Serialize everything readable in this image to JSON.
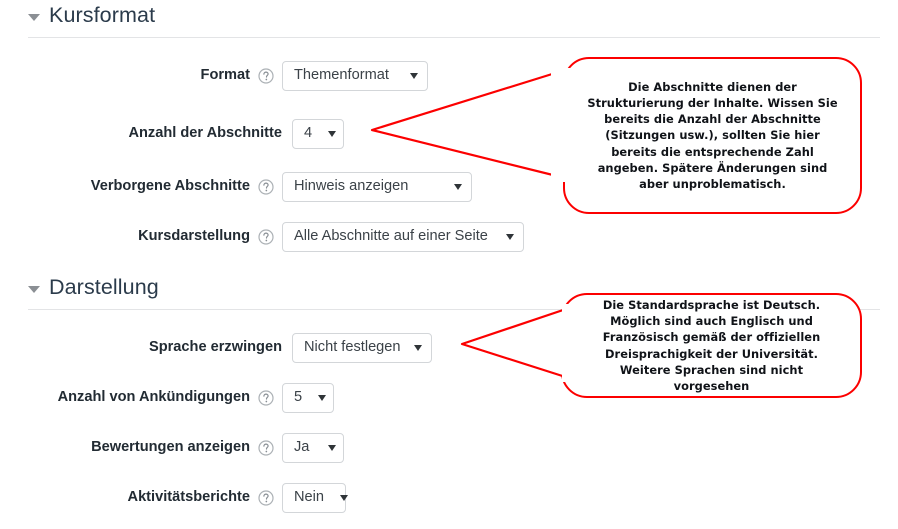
{
  "sections": [
    {
      "id": "kursformat",
      "title": "Kursformat",
      "caret_icon": "caret-down-icon",
      "rows": [
        {
          "id": "format",
          "label": "Format",
          "help_icon": "help-circle-icon",
          "has_help": true,
          "value": "Themenformat",
          "dropdown_icon": "caret-down-icon"
        },
        {
          "id": "anzahl-der-abschnitte",
          "label": "Anzahl der Abschnitte",
          "help_icon": "help-circle-icon",
          "has_help": false,
          "value": "4",
          "dropdown_icon": "caret-down-icon"
        },
        {
          "id": "verborgene-abschnitte",
          "label": "Verborgene Abschnitte",
          "help_icon": "help-circle-icon",
          "has_help": true,
          "value": "Hinweis anzeigen",
          "dropdown_icon": "caret-down-icon"
        },
        {
          "id": "kursdarstellung",
          "label": "Kursdarstellung",
          "help_icon": "help-circle-icon",
          "has_help": true,
          "value": "Alle Abschnitte auf einer Seite",
          "dropdown_icon": "caret-down-icon"
        }
      ]
    },
    {
      "id": "darstellung",
      "title": "Darstellung",
      "caret_icon": "caret-down-icon",
      "rows": [
        {
          "id": "sprache-erzwingen",
          "label": "Sprache erzwingen",
          "help_icon": "help-circle-icon",
          "has_help": false,
          "value": "Nicht festlegen",
          "dropdown_icon": "caret-down-icon"
        },
        {
          "id": "anzahl-von-ankuendigungen",
          "label": "Anzahl von Ankündigungen",
          "help_icon": "help-circle-icon",
          "has_help": true,
          "value": "5",
          "dropdown_icon": "caret-down-icon"
        },
        {
          "id": "bewertungen-anzeigen",
          "label": "Bewertungen anzeigen",
          "help_icon": "help-circle-icon",
          "has_help": true,
          "value": "Ja",
          "dropdown_icon": "caret-down-icon"
        },
        {
          "id": "aktivitaetsberichte",
          "label": "Aktivitätsberichte",
          "help_icon": "help-circle-icon",
          "has_help": true,
          "value": "Nein",
          "dropdown_icon": "caret-down-icon"
        }
      ]
    }
  ],
  "annotations": [
    {
      "id": "callout-abschnitte",
      "text": "Die Abschnitte dienen der Strukturierung der Inhalte. Wissen Sie bereits die Anzahl der Abschnitte (Sitzungen usw.), sollten Sie hier bereits die entsprechende Zahl angeben. Spätere Änderungen sind aber unproblematisch.",
      "color": "#fc0000",
      "points_to": "anzahl-der-abschnitte"
    },
    {
      "id": "callout-sprache",
      "text": "Die Standardsprache ist Deutsch. Möglich sind auch Englisch und Französisch gemäß der offiziellen Dreisprachigkeit der Universität. Weitere Sprachen sind nicht vorgesehen",
      "color": "#fc0000",
      "points_to": "sprache-erzwingen"
    }
  ],
  "colors": {
    "annotation": "#fc0000",
    "heading": "#2b3b4b",
    "label": "#222b33",
    "border": "#d3d6d9",
    "rule": "#e3e4e6"
  }
}
